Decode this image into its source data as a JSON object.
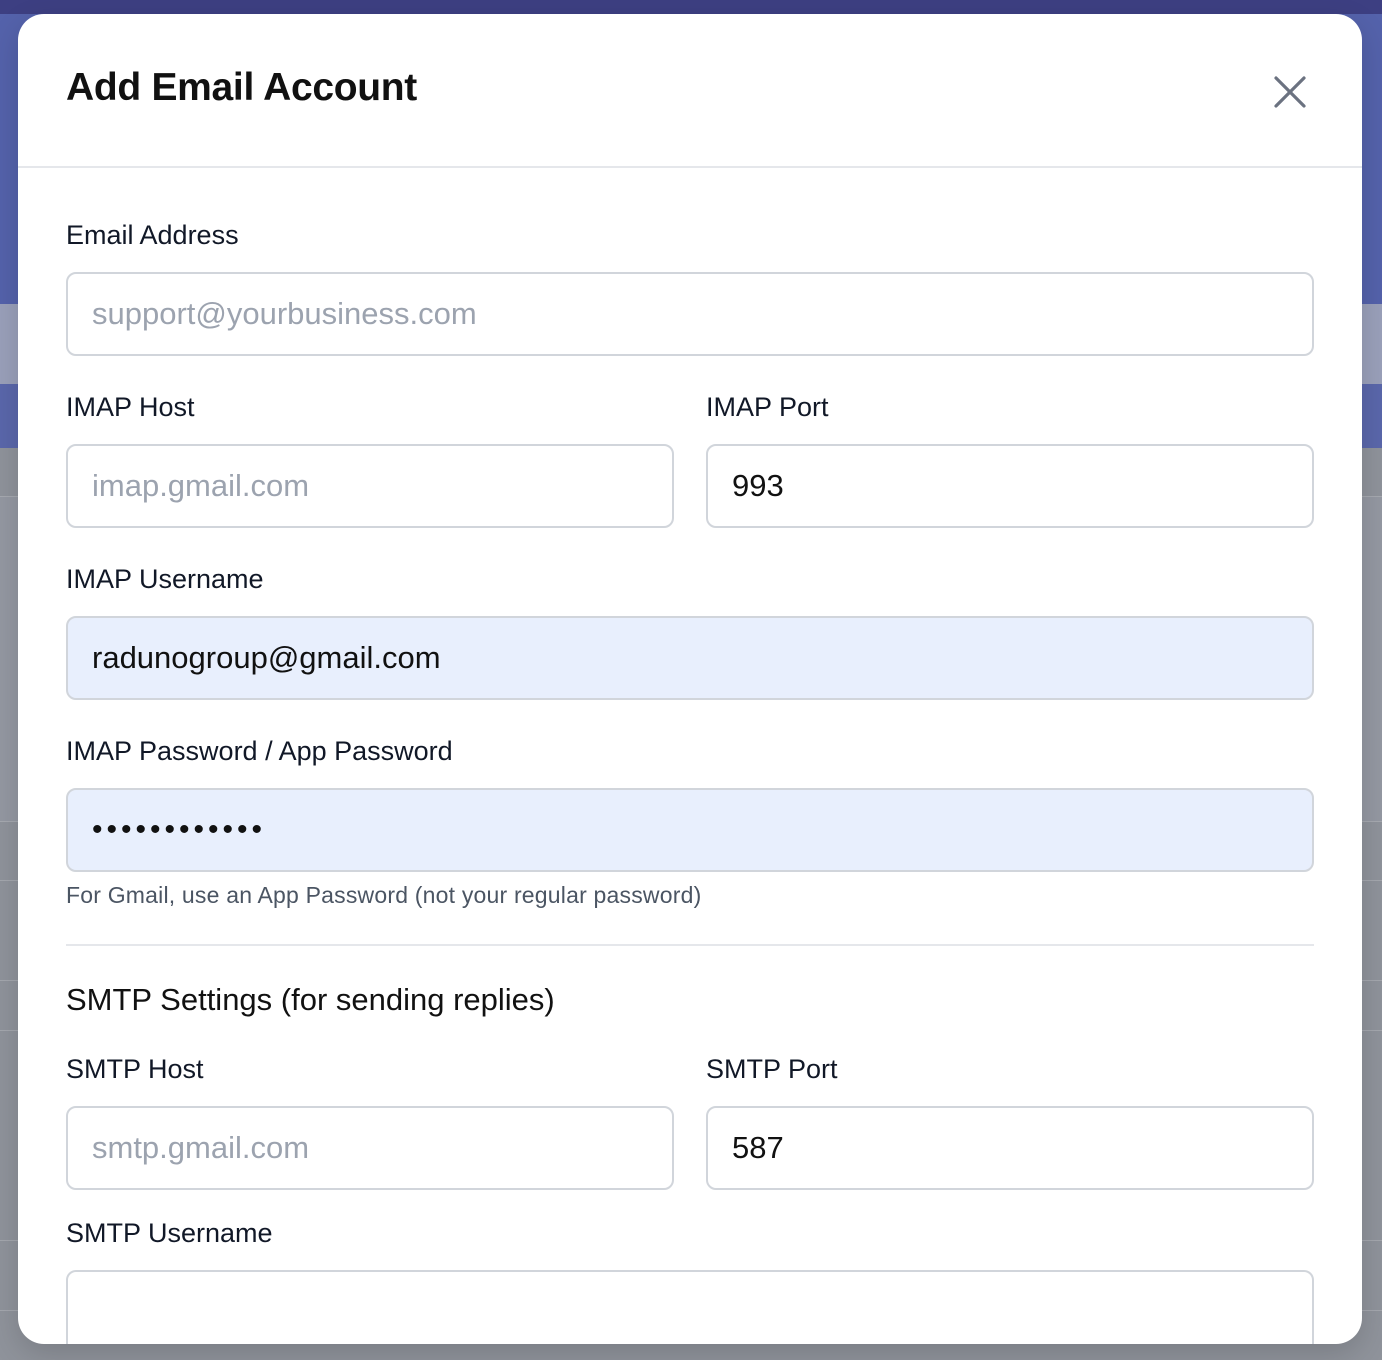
{
  "modal": {
    "title": "Add Email Account",
    "close_icon": "close-icon"
  },
  "fields": {
    "email": {
      "label": "Email Address",
      "placeholder": "support@yourbusiness.com",
      "value": ""
    },
    "imap_host": {
      "label": "IMAP Host",
      "placeholder": "imap.gmail.com",
      "value": ""
    },
    "imap_port": {
      "label": "IMAP Port",
      "value": "993"
    },
    "imap_username": {
      "label": "IMAP Username",
      "value": "radunogroup@gmail.com"
    },
    "imap_password": {
      "label": "IMAP Password / App Password",
      "value": "••••••••••••"
    },
    "imap_password_hint": "For Gmail, use an App Password (not your regular password)"
  },
  "smtp": {
    "section_title": "SMTP Settings (for sending replies)",
    "host": {
      "label": "SMTP Host",
      "placeholder": "smtp.gmail.com",
      "value": ""
    },
    "port": {
      "label": "SMTP Port",
      "value": "587"
    },
    "username": {
      "label": "SMTP Username",
      "value": ""
    }
  },
  "colors": {
    "autofill_bg": "#e8effd",
    "border": "#d1d5db",
    "placeholder": "#9ca3af"
  }
}
